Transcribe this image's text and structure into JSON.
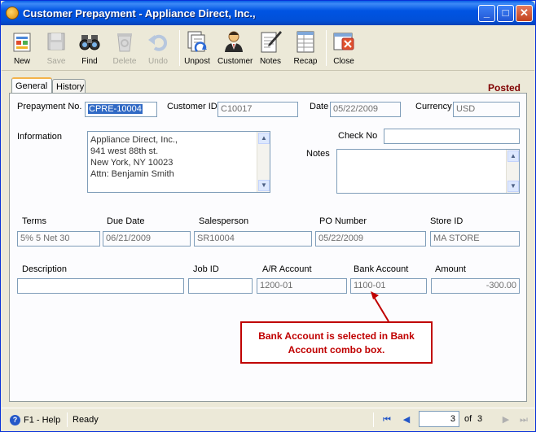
{
  "window": {
    "title": "Customer Prepayment - Appliance Direct, Inc.,",
    "minimize": "_",
    "maximize": "□",
    "close": "✕"
  },
  "toolbar": {
    "items": [
      {
        "label": "New",
        "icon": "new-document-icon",
        "enabled": true
      },
      {
        "label": "Save",
        "icon": "floppy-disk-icon",
        "enabled": false
      },
      {
        "label": "Find",
        "icon": "binoculars-icon",
        "enabled": true
      },
      {
        "label": "Delete",
        "icon": "recycle-bin-icon",
        "enabled": false
      },
      {
        "label": "Undo",
        "icon": "undo-arrow-icon",
        "enabled": false
      },
      {
        "label": "Unpost",
        "icon": "unpost-icon",
        "enabled": true
      },
      {
        "label": "Customer",
        "icon": "customer-person-icon",
        "enabled": true
      },
      {
        "label": "Notes",
        "icon": "notepad-pen-icon",
        "enabled": true
      },
      {
        "label": "Recap",
        "icon": "recap-grid-icon",
        "enabled": true
      },
      {
        "label": "Close",
        "icon": "close-window-icon",
        "enabled": true
      }
    ]
  },
  "tabs": [
    {
      "label": "General",
      "active": true
    },
    {
      "label": "History",
      "active": false
    }
  ],
  "status_badge": "Posted",
  "form": {
    "prepayment_no_label": "Prepayment No.",
    "prepayment_no": "CPRE-10004",
    "customer_id_label": "Customer ID",
    "customer_id": "C10017",
    "date_label": "Date",
    "date": "05/22/2009",
    "currency_label": "Currency",
    "currency": "USD",
    "information_label": "Information",
    "information_lines": [
      "Appliance Direct, Inc.,",
      "941 west 88th st.",
      "New York, NY 10023",
      "Attn: Benjamin Smith"
    ],
    "check_no_label": "Check No",
    "check_no": "",
    "notes_label": "Notes",
    "notes": "",
    "terms_label": "Terms",
    "terms": "5% 5 Net 30",
    "due_date_label": "Due Date",
    "due_date": "06/21/2009",
    "salesperson_label": "Salesperson",
    "salesperson": "SR10004",
    "po_number_label": "PO Number",
    "po_number": "05/22/2009",
    "store_id_label": "Store ID",
    "store_id": "MA STORE",
    "description_label": "Description",
    "description": "",
    "job_id_label": "Job ID",
    "job_id": "",
    "ar_account_label": "A/R Account",
    "ar_account": "1200-01",
    "bank_account_label": "Bank Account",
    "bank_account": "1100-01",
    "amount_label": "Amount",
    "amount": "-300.00"
  },
  "callout": {
    "line1": "Bank Account is selected in Bank",
    "line2": "Account combo box.",
    "color": "#c00000"
  },
  "statusbar": {
    "help": "F1 - Help",
    "status": "Ready",
    "page": "3",
    "of_label": "of",
    "total": "3"
  }
}
